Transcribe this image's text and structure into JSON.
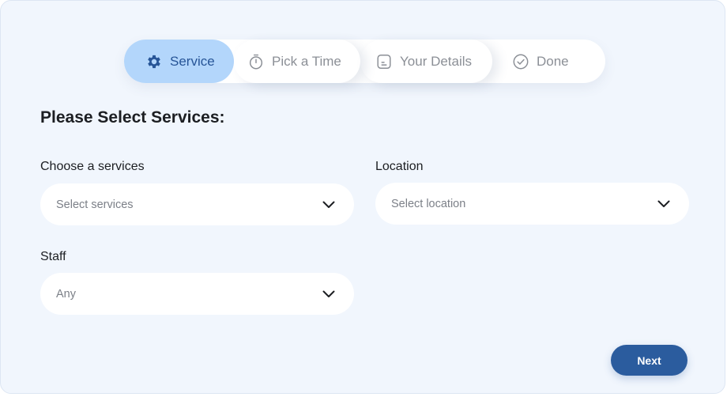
{
  "steps": [
    {
      "label": "Service",
      "icon": "gear-icon",
      "active": true
    },
    {
      "label": "Pick a Time",
      "icon": "stopwatch-icon",
      "active": false
    },
    {
      "label": "Your Details",
      "icon": "document-icon",
      "active": false
    },
    {
      "label": "Done",
      "icon": "check-circle-icon",
      "active": false
    }
  ],
  "form": {
    "title": "Please Select Services:",
    "services": {
      "label": "Choose a services",
      "placeholder": "Select services"
    },
    "location": {
      "label": "Location",
      "placeholder": "Select location"
    },
    "staff": {
      "label": "Staff",
      "value": "Any"
    }
  },
  "actions": {
    "next_label": "Next"
  },
  "colors": {
    "background": "#f1f6fd",
    "active_step": "#b3d6fb",
    "active_step_text": "#275597",
    "primary_button": "#2b5c9e",
    "muted_text": "#8b8f96"
  }
}
